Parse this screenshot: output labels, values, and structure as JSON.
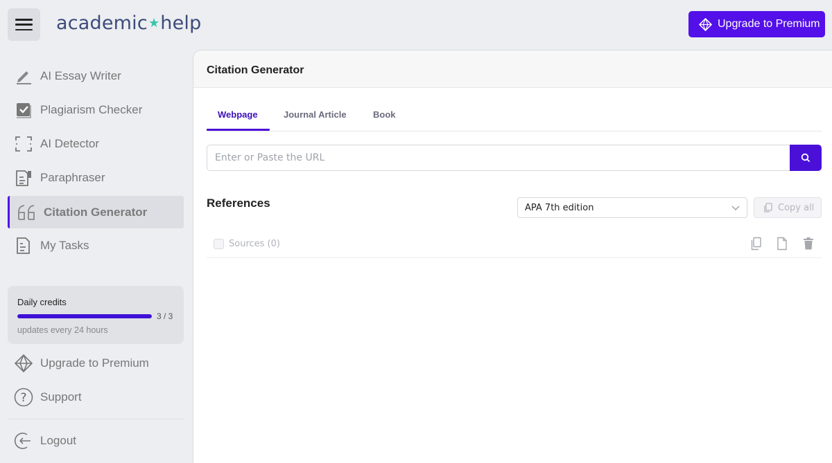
{
  "app": {
    "logo_left": "academic",
    "logo_star": "★",
    "logo_right": "help",
    "upgrade_button": "Upgrade to Premium",
    "accent_color": "#5310e8"
  },
  "sidebar": {
    "items": [
      {
        "label": "AI Essay Writer",
        "icon": "pencil-icon"
      },
      {
        "label": "Plagiarism Checker",
        "icon": "checkbox-icon"
      },
      {
        "label": "AI Detector",
        "icon": "scan-frame-icon"
      },
      {
        "label": "Paraphraser",
        "icon": "document-edit-icon"
      },
      {
        "label": "Citation Generator",
        "icon": "quote-icon",
        "active": true
      },
      {
        "label": "My Tasks",
        "icon": "tasks-icon"
      }
    ],
    "credits": {
      "title": "Daily credits",
      "count": "3 / 3",
      "progress": 1.0,
      "note": "updates every 24 hours"
    },
    "upgrade_label": "Upgrade to Premium",
    "support_label": "Support",
    "logout_label": "Logout"
  },
  "main": {
    "title": "Citation Generator",
    "tabs": [
      {
        "label": "Webpage",
        "active": true
      },
      {
        "label": "Journal Article"
      },
      {
        "label": "Book"
      }
    ],
    "url_placeholder": "Enter or Paste the URL",
    "references_title": "References",
    "citation_style": "APA 7th edition",
    "copy_all_label": "Copy all",
    "sources_label": "Sources (0)"
  }
}
